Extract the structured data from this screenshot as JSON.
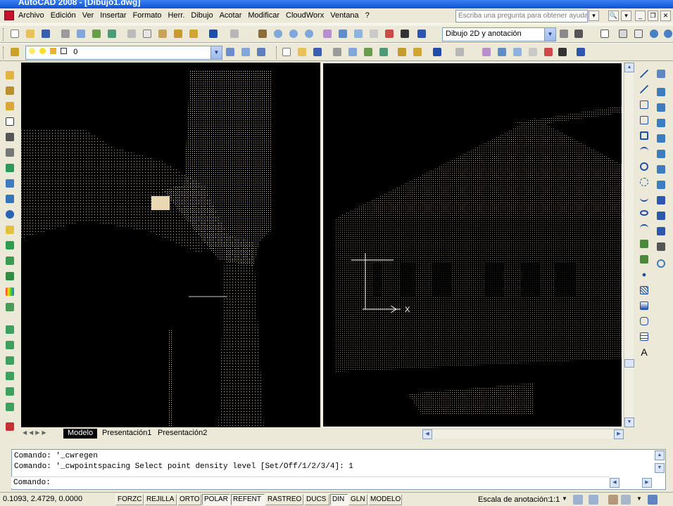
{
  "window": {
    "title": "AutoCAD 2008 - [Dibujo1.dwg]"
  },
  "menu": [
    "Archivo",
    "Edición",
    "Ver",
    "Insertar",
    "Formato",
    "Herr.",
    "Dibujo",
    "Acotar",
    "Modificar",
    "CloudWorx",
    "Ventana",
    "?"
  ],
  "help_search": {
    "placeholder": "Escriba una pregunta para obtener ayuda"
  },
  "workspace": {
    "value": "Dibujo 2D y anotación"
  },
  "layer": {
    "value": "0"
  },
  "layout_tabs": [
    {
      "label": "Modelo",
      "active": true
    },
    {
      "label": "Presentación1",
      "active": false
    },
    {
      "label": "Presentación2",
      "active": false
    }
  ],
  "command": {
    "lines": [
      "Comando: '_cwregen",
      "Comando: '_cwpointspacing Select point density level [Set/Off/1/2/3/4]: 1"
    ],
    "prompt": "Comando:"
  },
  "status": {
    "coords": "0.1093, 2.4729, 0.0000",
    "toggles": [
      "FORZC",
      "REJILLA",
      "ORTO",
      "POLAR",
      "REFENT",
      "RASTREO",
      "DUCS",
      "DIN",
      "GLN",
      "MODELO"
    ],
    "annotation_scale_label": "Escala de anotación:",
    "annotation_scale_value": "1:1"
  },
  "viewport": {
    "ucs_x_label": "X"
  },
  "colors": {
    "title_blue": "#0A53D6",
    "viewport_bg": "#000000",
    "active_tab": "#000000"
  }
}
